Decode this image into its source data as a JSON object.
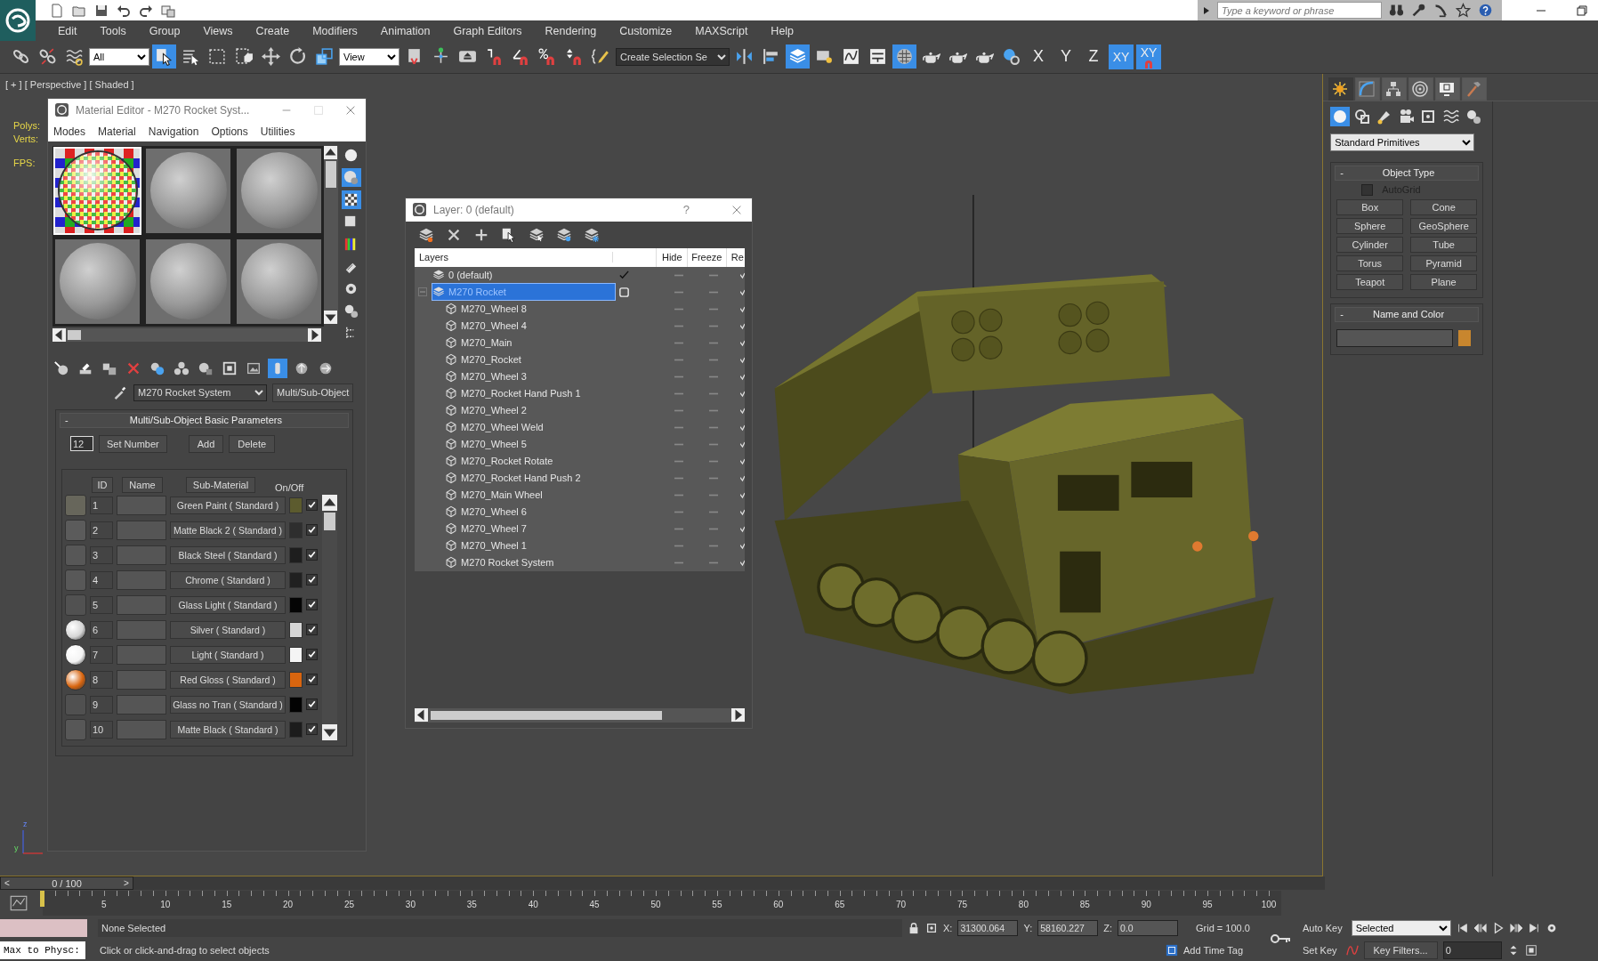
{
  "title_bar": {
    "search_placeholder": "Type a keyword or phrase"
  },
  "menu": [
    "Edit",
    "Tools",
    "Group",
    "Views",
    "Create",
    "Modifiers",
    "Animation",
    "Graph Editors",
    "Rendering",
    "Customize",
    "MAXScript",
    "Help"
  ],
  "toolbar": [
    {
      "kind": "link",
      "selected": false
    },
    {
      "kind": "unlink",
      "selected": false
    },
    {
      "kind": "bind",
      "selected": false
    },
    {
      "kind": "dropdown",
      "value": "All"
    },
    {
      "kind": "select",
      "selected": true
    },
    {
      "kind": "select-by-name",
      "selected": false
    },
    {
      "kind": "region",
      "selected": false
    },
    {
      "kind": "crossing",
      "selected": false
    },
    {
      "kind": "move",
      "selected": false
    },
    {
      "kind": "rotate",
      "selected": false
    },
    {
      "kind": "scale",
      "selected": false
    },
    {
      "kind": "dropdown",
      "value": "View"
    },
    {
      "kind": "pivot",
      "selected": false
    },
    {
      "kind": "manipulate",
      "selected": false
    },
    {
      "kind": "shortcut",
      "selected": false
    },
    {
      "kind": "snap",
      "selected": false
    },
    {
      "kind": "angle-snap",
      "selected": false
    },
    {
      "kind": "percent-snap",
      "selected": false
    },
    {
      "kind": "spinner-snap",
      "selected": false
    },
    {
      "kind": "named-sets",
      "selected": false
    },
    {
      "kind": "dropdown",
      "value": "Create Selection Se"
    },
    {
      "kind": "mirror",
      "selected": false
    },
    {
      "kind": "align",
      "selected": false
    },
    {
      "kind": "layers",
      "selected": true
    },
    {
      "kind": "explorer",
      "selected": false
    },
    {
      "kind": "curves",
      "selected": false
    },
    {
      "kind": "schematic",
      "selected": false
    },
    {
      "kind": "material",
      "selected": true
    },
    {
      "kind": "render-setup",
      "selected": false
    },
    {
      "kind": "render-frame",
      "selected": false
    },
    {
      "kind": "render",
      "selected": false
    },
    {
      "kind": "snap-toggle",
      "selected": false
    },
    {
      "kind": "axis",
      "label": "X",
      "selected": false
    },
    {
      "kind": "axis",
      "label": "Y",
      "selected": false
    },
    {
      "kind": "axis",
      "label": "Z",
      "selected": false
    },
    {
      "kind": "axis",
      "label": "XY",
      "selected": true
    },
    {
      "kind": "axis-snap",
      "label": "XY",
      "selected": true
    }
  ],
  "viewport": {
    "label": "[ + ] [ Perspective ] [ Shaded ]",
    "stats": [
      "Polys:",
      "Verts:",
      "FPS:"
    ],
    "tripod": [
      "z",
      "y"
    ]
  },
  "material_editor": {
    "title": "Material Editor - M270 Rocket Syst...",
    "menu": [
      "Modes",
      "Material",
      "Navigation",
      "Options",
      "Utilities"
    ],
    "slots": [
      {
        "kind": "checker",
        "selected": true
      },
      {
        "kind": "plain",
        "selected": false
      },
      {
        "kind": "plain",
        "selected": false
      },
      {
        "kind": "plain",
        "selected": false
      },
      {
        "kind": "plain",
        "selected": false
      },
      {
        "kind": "plain",
        "selected": false
      }
    ],
    "side_tools": [
      {
        "kind": "sample",
        "selected": false
      },
      {
        "kind": "backlight",
        "selected": true
      },
      {
        "kind": "background",
        "selected": true
      },
      {
        "kind": "tiling",
        "selected": false
      },
      {
        "kind": "video",
        "selected": false
      },
      {
        "kind": "preview",
        "selected": false
      },
      {
        "kind": "options",
        "selected": false
      },
      {
        "kind": "by-material",
        "selected": false
      },
      {
        "kind": "navigator",
        "selected": false
      }
    ],
    "tools": [
      {
        "kind": "get",
        "selected": false
      },
      {
        "kind": "put",
        "selected": false
      },
      {
        "kind": "assign",
        "selected": false
      },
      {
        "kind": "reset",
        "selected": false
      },
      {
        "kind": "copy",
        "selected": false
      },
      {
        "kind": "unique",
        "selected": false
      },
      {
        "kind": "library",
        "selected": false
      },
      {
        "kind": "effects",
        "selected": false
      },
      {
        "kind": "map",
        "selected": false
      },
      {
        "kind": "result",
        "selected": true
      },
      {
        "kind": "parent",
        "selected": false
      },
      {
        "kind": "sibling",
        "selected": false
      }
    ],
    "material_name": "M270 Rocket System",
    "material_type": "Multi/Sub-Object",
    "rollout": "Multi/Sub-Object Basic Parameters",
    "collapse": "-",
    "count": "12",
    "buttons": [
      "Set Number",
      "Add",
      "Delete"
    ],
    "columns": [
      "ID",
      "Name",
      "Sub-Material",
      "On/Off"
    ],
    "rows": [
      {
        "id": "1",
        "sub_material": "Green Paint ( Standard )",
        "kind": "flat",
        "color": "#5c5b2e",
        "checked": true
      },
      {
        "id": "2",
        "sub_material": "Matte Black 2 ( Standard )",
        "kind": "flat",
        "color": "#2e2e2e",
        "checked": true
      },
      {
        "id": "3",
        "sub_material": "Black Steel ( Standard )",
        "kind": "flat",
        "color": "#1e1e1e",
        "checked": true
      },
      {
        "id": "4",
        "sub_material": "Chrome ( Standard )",
        "kind": "flat",
        "color": "#202020",
        "checked": true
      },
      {
        "id": "5",
        "sub_material": "Glass Light ( Standard )",
        "kind": "flat",
        "color": "#050505",
        "checked": true
      },
      {
        "id": "6",
        "sub_material": "Silver ( Standard )",
        "kind": "sphere",
        "color": "#d6d6d6",
        "checked": true
      },
      {
        "id": "7",
        "sub_material": "Light ( Standard )",
        "kind": "sphere",
        "color": "#f4f4f4",
        "checked": true
      },
      {
        "id": "8",
        "sub_material": "Red Gloss ( Standard )",
        "kind": "sphere",
        "color": "#d8650f",
        "checked": true
      },
      {
        "id": "9",
        "sub_material": "Glass no Tran ( Standard )",
        "kind": "flat",
        "color": "#030303",
        "checked": true
      },
      {
        "id": "10",
        "sub_material": "Matte Black ( Standard )",
        "kind": "flat",
        "color": "#1c1c1c",
        "checked": true
      }
    ]
  },
  "layer_dialog": {
    "title": "Layer: 0 (default)",
    "help": "?",
    "tools": [
      {
        "kind": "new"
      },
      {
        "kind": "delete"
      },
      {
        "kind": "add"
      },
      {
        "kind": "select"
      },
      {
        "kind": "highlight"
      },
      {
        "kind": "hide"
      },
      {
        "kind": "freeze"
      }
    ],
    "columns": [
      "Layers",
      "Hide",
      "Freeze",
      "Re"
    ],
    "layers": [
      {
        "name": "0 (default)",
        "current": true,
        "selected": false
      },
      {
        "name": "M270 Rocket",
        "current": false,
        "selected": true,
        "expanded": true,
        "children": [
          {
            "name": "M270_Wheel 8",
            "selected": false
          },
          {
            "name": "M270_Wheel 4",
            "selected": false
          },
          {
            "name": "M270_Main",
            "selected": false
          },
          {
            "name": "M270_Rocket",
            "selected": false
          },
          {
            "name": "M270_Wheel 3",
            "selected": false
          },
          {
            "name": "M270_Rocket Hand Push 1",
            "selected": false
          },
          {
            "name": "M270_Wheel 2",
            "selected": false
          },
          {
            "name": "M270_Wheel Weld",
            "selected": false
          },
          {
            "name": "M270_Wheel 5",
            "selected": false
          },
          {
            "name": "M270_Rocket Rotate",
            "selected": false
          },
          {
            "name": "M270_Rocket Hand Push 2",
            "selected": false
          },
          {
            "name": "M270_Main Wheel",
            "selected": false
          },
          {
            "name": "M270_Wheel 6",
            "selected": false
          },
          {
            "name": "M270_Wheel 7",
            "selected": false
          },
          {
            "name": "M270_Wheel 1",
            "selected": false
          },
          {
            "name": "M270 Rocket System",
            "selected": false
          }
        ]
      }
    ]
  },
  "command_panel": {
    "tabs": [
      {
        "kind": "create",
        "selected": true
      },
      {
        "kind": "modify",
        "selected": false
      },
      {
        "kind": "hierarchy",
        "selected": false
      },
      {
        "kind": "motion",
        "selected": false
      },
      {
        "kind": "display",
        "selected": false
      },
      {
        "kind": "utilities",
        "selected": false
      }
    ],
    "categories": [
      {
        "kind": "geometry",
        "selected": true
      },
      {
        "kind": "shapes",
        "selected": false
      },
      {
        "kind": "lights",
        "selected": false
      },
      {
        "kind": "cameras",
        "selected": false
      },
      {
        "kind": "helpers",
        "selected": false
      },
      {
        "kind": "spacewarps",
        "selected": false
      },
      {
        "kind": "systems",
        "selected": false
      }
    ],
    "dropdown": "Standard Primitives",
    "object_type": {
      "title": "Object Type",
      "collapse": "-",
      "autogrid": {
        "label": "AutoGrid",
        "checked": false,
        "disabled": true
      },
      "buttons": [
        "Box",
        "Cone",
        "Sphere",
        "GeoSphere",
        "Cylinder",
        "Tube",
        "Torus",
        "Pyramid",
        "Teapot",
        "Plane"
      ]
    },
    "name_and_color": {
      "title": "Name and Color",
      "collapse": "-",
      "color": "#c8862e"
    }
  },
  "timeline": {
    "prev": "<",
    "position": "0 / 100",
    "next": ">",
    "level": 0,
    "ticks": [
      "5",
      "10",
      "15",
      "20",
      "25",
      "30",
      "35",
      "40",
      "45",
      "50",
      "55",
      "60",
      "65",
      "70",
      "75",
      "80",
      "85",
      "90",
      "95",
      "100"
    ]
  },
  "status_bar": {
    "listener": "Max to Physc:",
    "selection": "None Selected",
    "prompt": "Click or click-and-drag to select objects",
    "coords": [
      {
        "label": "X:",
        "value": "31300.064"
      },
      {
        "label": "Y:",
        "value": "58160.227"
      },
      {
        "label": "Z:",
        "value": "0.0"
      }
    ],
    "grid": "Grid = 100.0",
    "time_tag": "Add Time Tag",
    "auto_key": "Auto Key",
    "key_mode": "Selected",
    "set_key": "Set Key",
    "key_filters": "Key Filters...",
    "frame": "0"
  }
}
